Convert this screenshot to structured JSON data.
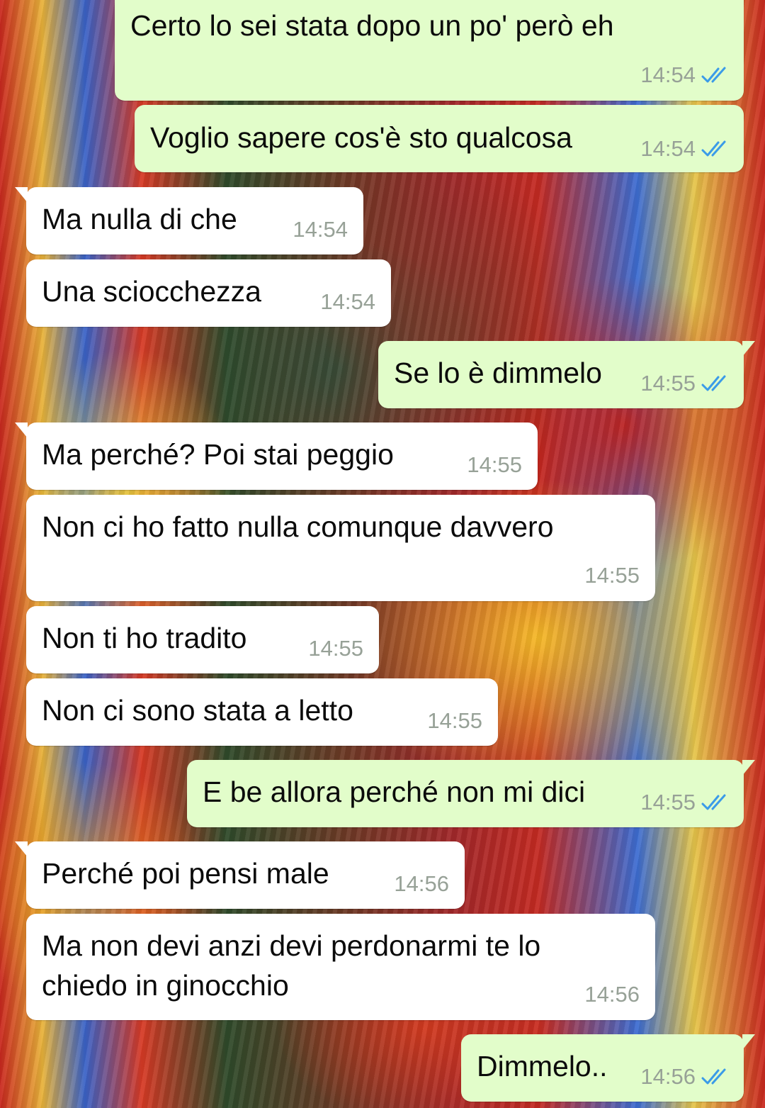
{
  "chat": {
    "messages": [
      {
        "direction": "out",
        "text": "Certo lo sei stata dopo un po' però eh",
        "time": "14:54",
        "status": "read-double-tick"
      },
      {
        "direction": "out",
        "text": "Voglio sapere cos'è sto qualcosa",
        "time": "14:54",
        "status": "read-double-tick"
      },
      {
        "direction": "in",
        "text": "Ma nulla di che",
        "time": "14:54"
      },
      {
        "direction": "in",
        "text": "Una sciocchezza",
        "time": "14:54"
      },
      {
        "direction": "out",
        "text": "Se lo è dimmelo",
        "time": "14:55",
        "status": "read-double-tick"
      },
      {
        "direction": "in",
        "text": "Ma perché? Poi stai peggio",
        "time": "14:55"
      },
      {
        "direction": "in",
        "text": "Non ci ho fatto nulla comunque davvero",
        "time": "14:55"
      },
      {
        "direction": "in",
        "text": "Non ti ho tradito",
        "time": "14:55"
      },
      {
        "direction": "in",
        "text": "Non ci sono stata a letto",
        "time": "14:55"
      },
      {
        "direction": "out",
        "text": "E be allora perché non mi dici",
        "time": "14:55",
        "status": "read-double-tick"
      },
      {
        "direction": "in",
        "text": "Perché poi pensi male",
        "time": "14:56"
      },
      {
        "direction": "in",
        "text": "Ma non devi anzi devi perdonarmi te lo\nchiedo in ginocchio",
        "time": "14:56"
      },
      {
        "direction": "out",
        "text": "Dimmelo..",
        "time": "14:56",
        "status": "read-double-tick"
      }
    ]
  },
  "colors": {
    "outgoing_bubble": "#e2fdca",
    "incoming_bubble": "#ffffff",
    "read_tick": "#3b9be8",
    "timestamp": "#97a197"
  },
  "icons": {
    "read_status": "double-check-icon"
  }
}
